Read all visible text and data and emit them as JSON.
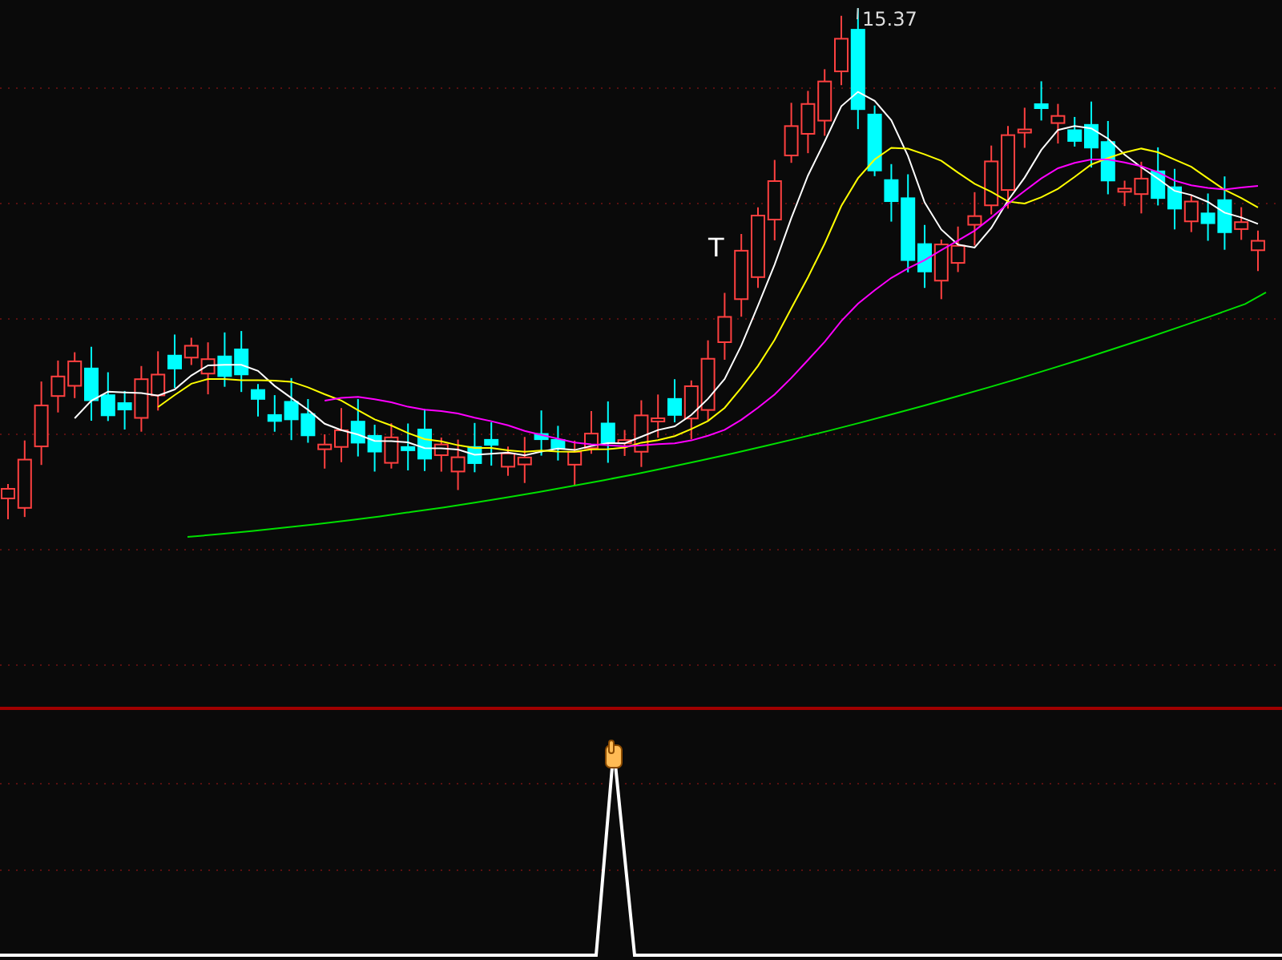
{
  "price_panel": {
    "high_label": "15.37",
    "signal_mark": "T"
  }
}
